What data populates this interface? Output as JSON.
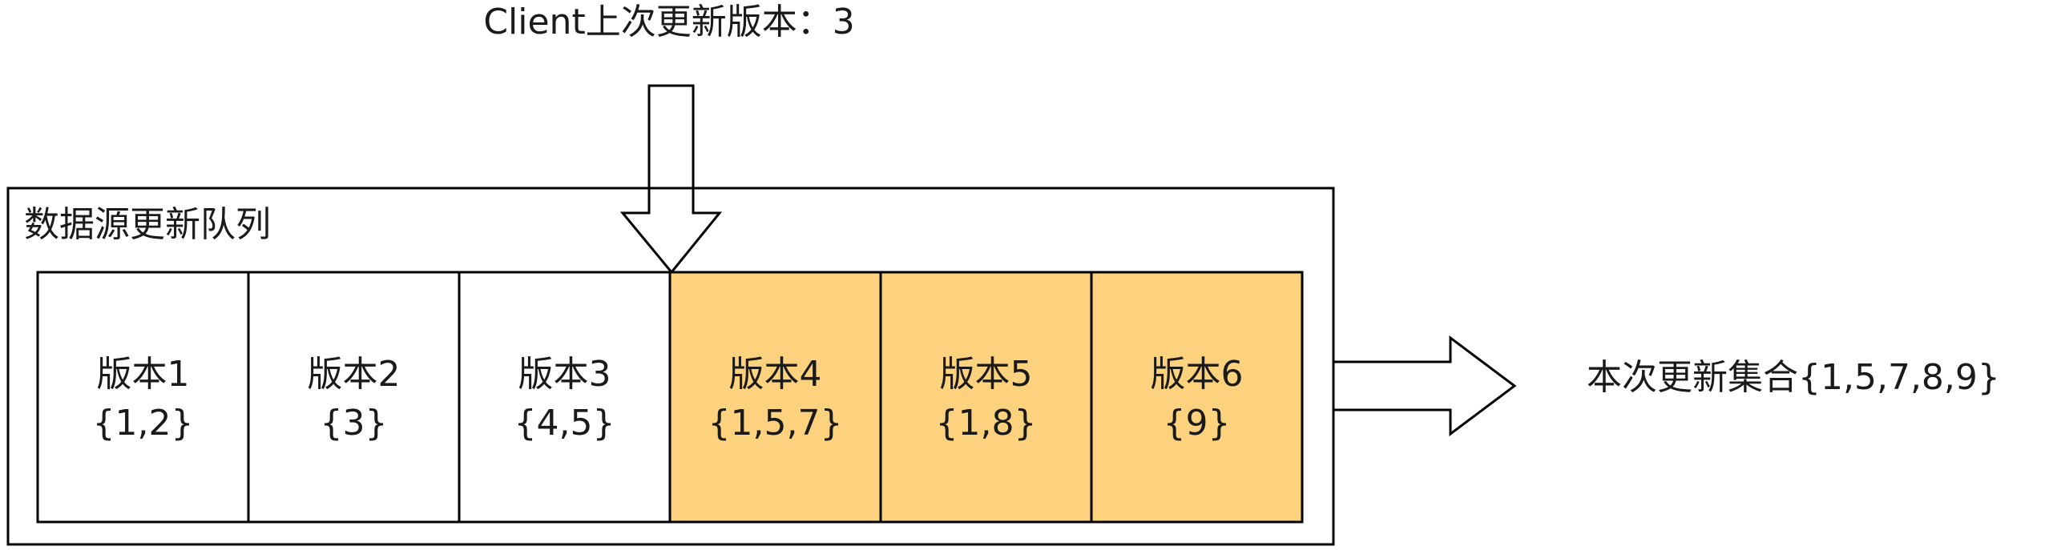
{
  "client_label": "Client上次更新版本：3",
  "queue": {
    "title": "数据源更新队列",
    "versions": [
      {
        "name": "版本1",
        "set": "{1,2}",
        "highlighted": false
      },
      {
        "name": "版本2",
        "set": "{3}",
        "highlighted": false
      },
      {
        "name": "版本3",
        "set": "{4,5}",
        "highlighted": false
      },
      {
        "name": "版本4",
        "set": "{1,5,7}",
        "highlighted": true
      },
      {
        "name": "版本5",
        "set": "{1,8}",
        "highlighted": true
      },
      {
        "name": "版本6",
        "set": "{9}",
        "highlighted": true
      }
    ]
  },
  "result_label": "本次更新集合{1,5,7,8,9}",
  "colors": {
    "highlight_fill": "#fdd27e",
    "normal_fill": "#ffffff",
    "stroke": "#000000"
  }
}
